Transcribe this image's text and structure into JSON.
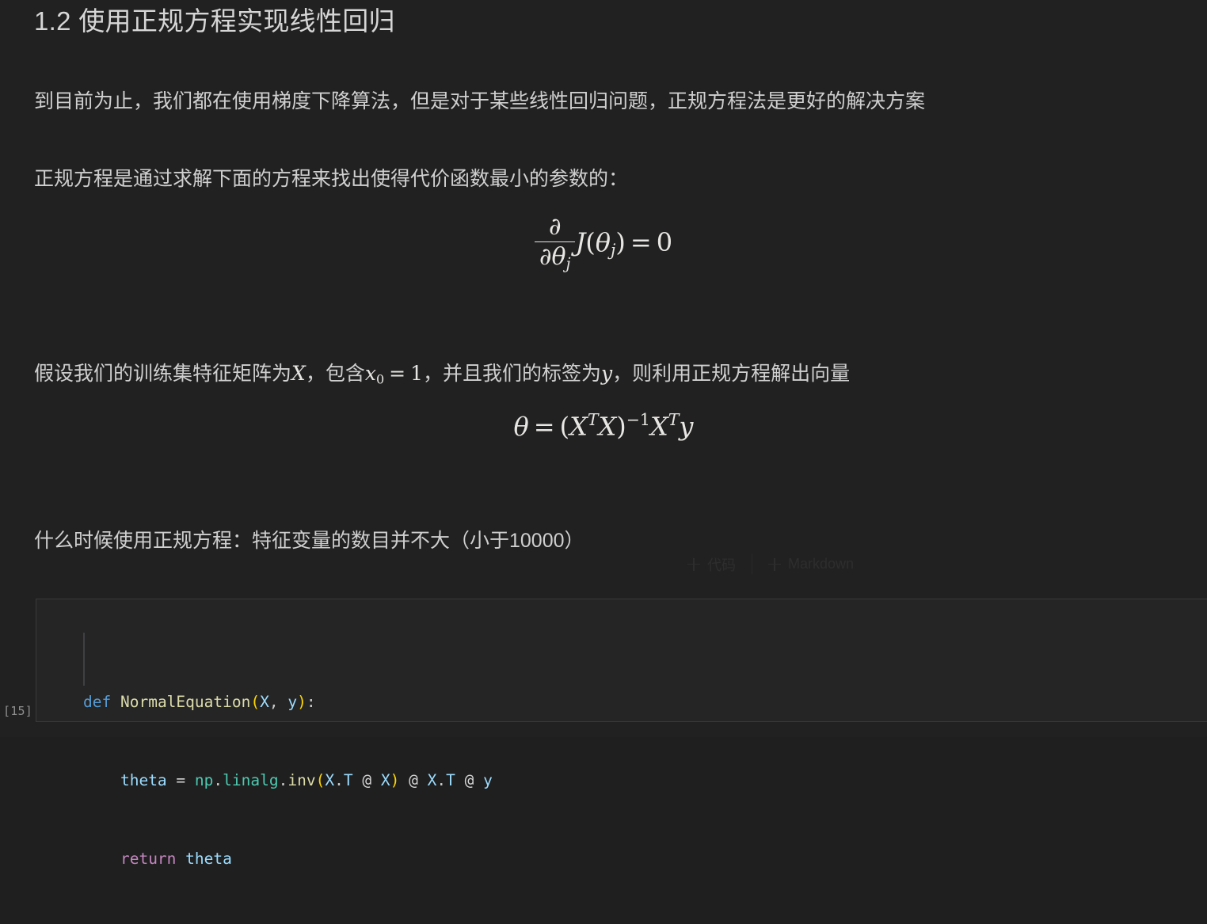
{
  "document": {
    "heading": "1.2 使用正规方程实现线性回归",
    "paragraphs": {
      "p1": "到目前为止，我们都在使用梯度下降算法，但是对于某些线性回归问题，正规方程法是更好的解决方案",
      "p2": "正规方程是通过求解下面的方程来找出使得代价函数最小的参数的：",
      "p3_part1": "假设我们的训练集特征矩阵为",
      "p3_math1": "X",
      "p3_part2": "，包含",
      "p3_math2_base": "x",
      "p3_math2_sub": "0",
      "p3_math2_eq": "=",
      "p3_math2_val": "1",
      "p3_part3": "，并且我们的标签为",
      "p3_math3": "y",
      "p3_part4": "，则利用正规方程解出向量",
      "p4": "什么时候使用正规方程：特征变量的数目并不大（小于10000）"
    },
    "equations": {
      "eq1": {
        "partial_symbol": "∂",
        "denominator_symbol": "∂θ",
        "denominator_sub": "j",
        "function": "J",
        "open_paren": "(",
        "theta": "θ",
        "theta_sub": "j",
        "close_paren": ")",
        "equals": "=",
        "rhs": "0",
        "plain": "∂/∂θ_j J(θ_j) = 0"
      },
      "eq2": {
        "theta": "θ",
        "equals": "=",
        "open_paren": "(",
        "X1": "X",
        "T1": "T",
        "X2": "X",
        "close_paren": ")",
        "inverse": "−1",
        "X3": "X",
        "T2": "T",
        "y": "y",
        "plain": "θ = (X^T X)^{-1} X^T y"
      }
    }
  },
  "insert_toolbar": {
    "code_label": "代码",
    "markdown_label": "Markdown",
    "plus_icon": "plus-icon"
  },
  "code_cell": {
    "execution_count": "[15]",
    "lines": [
      {
        "tokens": [
          {
            "text": "def",
            "type": "keyword"
          },
          {
            "text": " ",
            "type": "plain"
          },
          {
            "text": "NormalEquation",
            "type": "function"
          },
          {
            "text": "(",
            "type": "paren"
          },
          {
            "text": "X",
            "type": "variable"
          },
          {
            "text": ",",
            "type": "punct"
          },
          {
            "text": " ",
            "type": "plain"
          },
          {
            "text": "y",
            "type": "variable"
          },
          {
            "text": ")",
            "type": "paren"
          },
          {
            "text": ":",
            "type": "punct"
          }
        ],
        "plain": "def NormalEquation(X, y):"
      },
      {
        "tokens": [
          {
            "text": "    ",
            "type": "plain"
          },
          {
            "text": "theta",
            "type": "variable"
          },
          {
            "text": " ",
            "type": "plain"
          },
          {
            "text": "=",
            "type": "operator"
          },
          {
            "text": " ",
            "type": "plain"
          },
          {
            "text": "np",
            "type": "module"
          },
          {
            "text": ".",
            "type": "punct"
          },
          {
            "text": "linalg",
            "type": "module"
          },
          {
            "text": ".",
            "type": "punct"
          },
          {
            "text": "inv",
            "type": "function"
          },
          {
            "text": "(",
            "type": "paren"
          },
          {
            "text": "X",
            "type": "variable"
          },
          {
            "text": ".",
            "type": "punct"
          },
          {
            "text": "T",
            "type": "variable"
          },
          {
            "text": " ",
            "type": "plain"
          },
          {
            "text": "@",
            "type": "operator"
          },
          {
            "text": " ",
            "type": "plain"
          },
          {
            "text": "X",
            "type": "variable"
          },
          {
            "text": ")",
            "type": "paren"
          },
          {
            "text": " ",
            "type": "plain"
          },
          {
            "text": "@",
            "type": "operator"
          },
          {
            "text": " ",
            "type": "plain"
          },
          {
            "text": "X",
            "type": "variable"
          },
          {
            "text": ".",
            "type": "punct"
          },
          {
            "text": "T",
            "type": "variable"
          },
          {
            "text": " ",
            "type": "plain"
          },
          {
            "text": "@",
            "type": "operator"
          },
          {
            "text": " ",
            "type": "plain"
          },
          {
            "text": "y",
            "type": "variable"
          }
        ],
        "plain": "    theta = np.linalg.inv(X.T @ X) @ X.T @ y"
      },
      {
        "tokens": [
          {
            "text": "    ",
            "type": "plain"
          },
          {
            "text": "return",
            "type": "keyword-control"
          },
          {
            "text": " ",
            "type": "plain"
          },
          {
            "text": "theta",
            "type": "variable"
          }
        ],
        "plain": "    return theta"
      }
    ]
  },
  "colors": {
    "page_background": "#212121",
    "code_background": "#252526",
    "code_border": "#3a3a3c",
    "text": "#cfcfcf",
    "heading": "#d6d6d6",
    "keyword": "#569cd6",
    "keyword_control": "#c586c0",
    "function": "#dcdcaa",
    "variable": "#9cdcfe",
    "module": "#4ec9b0",
    "paren": "#ffd700",
    "punct": "#cccccc",
    "operator": "#d4d4d4",
    "execution_count": "#8f8f8f",
    "indent_guide": "#3f4042"
  }
}
